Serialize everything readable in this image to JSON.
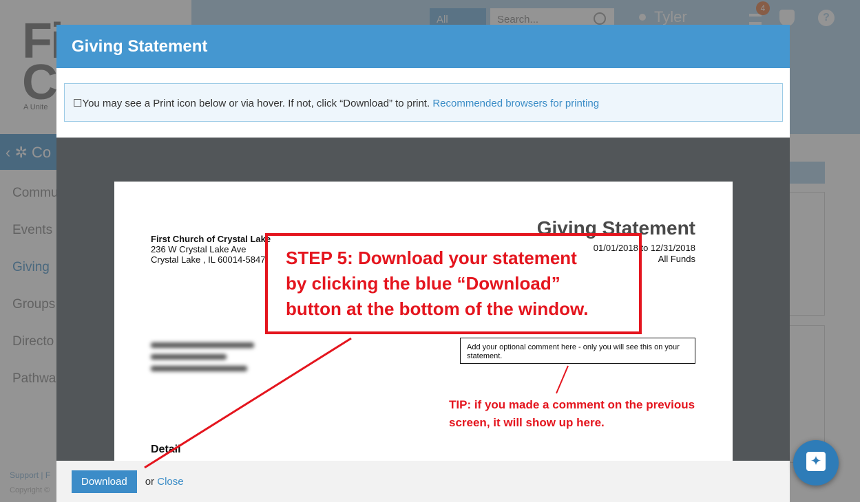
{
  "app": {
    "logo_text": "Fi\nCl",
    "logo_sub": "A Unite",
    "search_scope": "All",
    "search_placeholder": "Search...",
    "user_name": "Tyler",
    "notification_count": "4",
    "help_label": "?",
    "section_title": "Co",
    "nav_items": [
      "Commu",
      "Events",
      "Giving",
      "Groups",
      "Directo",
      "Pathwa"
    ],
    "footer_link": "Support | F",
    "footer_copy": "Copyright ©"
  },
  "modal": {
    "title": "Giving Statement",
    "notice_text": "☐You may see a Print icon below or via hover. If not, click “Download” to print. ",
    "notice_link": "Recommended browsers for printing",
    "download_label": "Download",
    "or_text": "or",
    "close_label": "Close"
  },
  "statement": {
    "org_name": "First Church of Crystal Lake",
    "org_address1": "236 W Crystal Lake Ave",
    "org_address2": "Crystal Lake , IL 60014-5847",
    "title": "Giving Statement",
    "date_range": "01/01/2018 to 12/31/2018",
    "funds": "All Funds",
    "comment": "Add your optional comment here - only you will see this on your statement.",
    "detail_heading": "Detail"
  },
  "annotations": {
    "step_lines": [
      "STEP 5: Download your statement",
      "by clicking the blue “Download”",
      "button at the bottom of the window."
    ],
    "tip_lines": [
      "TIP: if you made a comment on the previous",
      "screen, it will show up here."
    ],
    "accent_color": "#e4151e"
  },
  "colors": {
    "header_blue": "#4597d0",
    "button_blue": "#3c8cc8",
    "viewer_gray": "#525659"
  }
}
